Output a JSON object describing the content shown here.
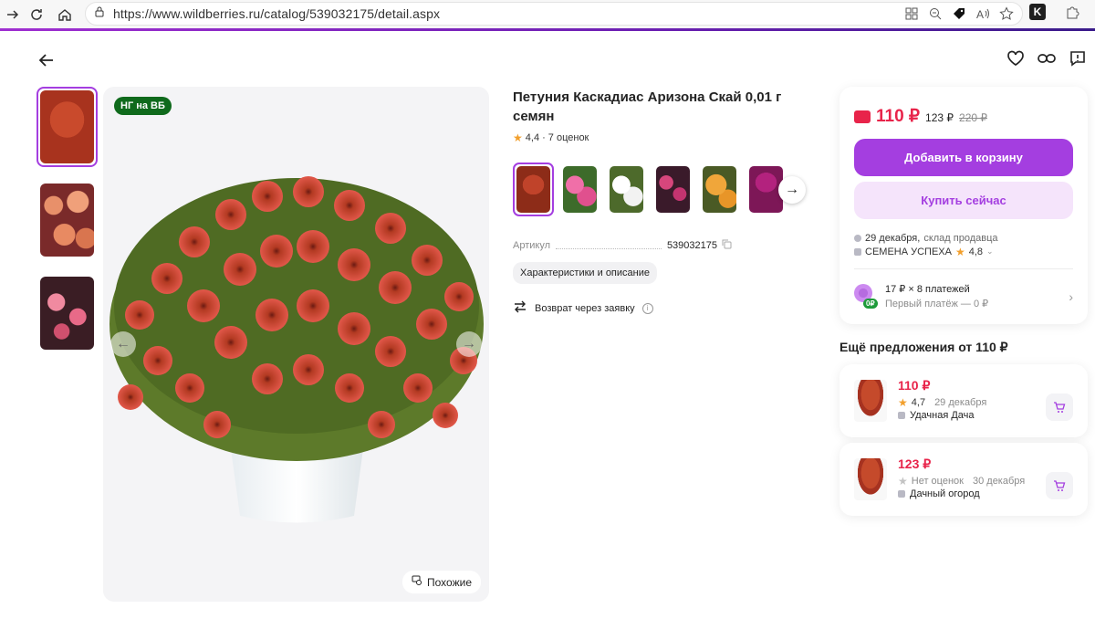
{
  "browser": {
    "url": "https://www.wildberries.ru/catalog/539032175/detail.aspx"
  },
  "product": {
    "badge": "НГ на ВБ",
    "title": "Петуния Каскадиас Аризона Скай 0,01 г семян",
    "rating": "4,4",
    "reviews": "· 7 оценок",
    "article_label": "Артикул",
    "article_value": "539032175",
    "chip": "Характеристики и описание",
    "return_text": "Возврат через заявку",
    "similar": "Похожие"
  },
  "buy": {
    "price": "110 ₽",
    "price_card": "123 ₽",
    "price_old": "220 ₽",
    "add_to_cart": "Добавить в корзину",
    "buy_now": "Купить сейчас",
    "delivery_date": "29 декабря,",
    "delivery_source": "склад продавца",
    "seller": "СЕМЕНА УСПЕХА",
    "seller_rating": "4,8",
    "installment_main": "17 ₽ × 8 платежей",
    "installment_sub": "Первый платёж — 0 ₽",
    "installment_badge": "0₽"
  },
  "more": {
    "title": "Ещё предложения от 110 ₽",
    "offers": [
      {
        "price": "110 ₽",
        "rating": "4,7",
        "date": "29 декабря",
        "seller": "Удачная Дача"
      },
      {
        "price": "123 ₽",
        "rating": "Нет оценок",
        "date": "30 декабря",
        "seller": "Дачный огород"
      }
    ]
  },
  "colors": {
    "accent": "#a43ee0",
    "price_red": "#e8244a",
    "badge_green": "#0f6a1c"
  }
}
